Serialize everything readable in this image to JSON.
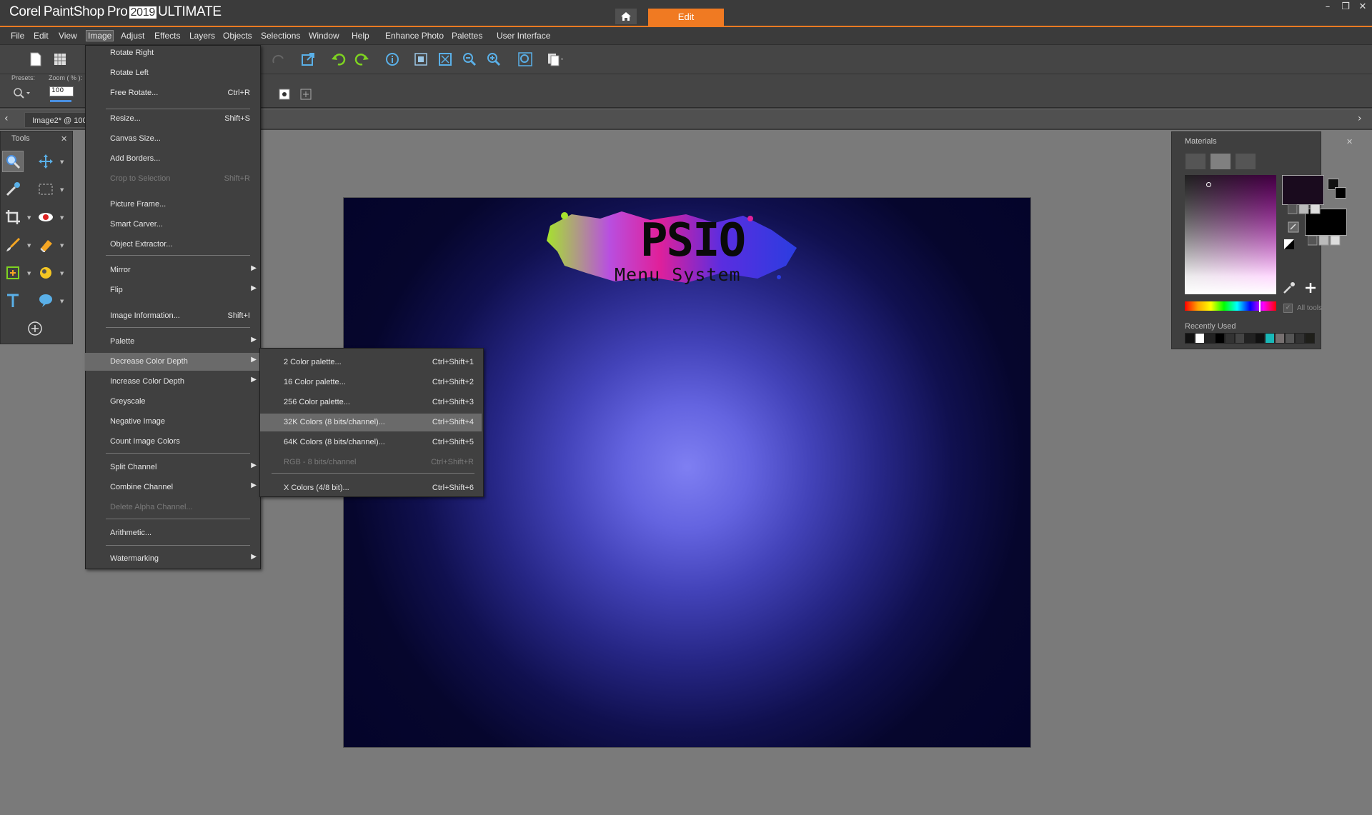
{
  "app": {
    "brand": "Corel",
    "name": "PaintShop",
    "suffix": "Pro",
    "year": "2019",
    "edition": "ULTIMATE",
    "mode_tab": "Edit"
  },
  "menubar": [
    "File",
    "Edit",
    "View",
    "Image",
    "Adjust",
    "Effects",
    "Layers",
    "Objects",
    "Selections",
    "Window",
    "Help",
    "Enhance Photo",
    "Palettes",
    "User Interface"
  ],
  "tool_options": {
    "presets_label": "Presets:",
    "zoom_label": "Zoom ( % ):",
    "zoom_value": "100"
  },
  "document_tab": "Image2* @ 100%",
  "tools_palette": {
    "title": "Tools"
  },
  "canvas": {
    "logo_main": "PSIO",
    "logo_sub": "Menu System"
  },
  "materials": {
    "title": "Materials",
    "all_tools": "All tools",
    "recently_used": "Recently Used",
    "recent_colors": [
      "#111111",
      "#ffffff",
      "#222222",
      "#000000",
      "#333333",
      "#444444",
      "#222222",
      "#111111",
      "#19b8b8",
      "#777070",
      "#555555",
      "#333333",
      "#1f1f1a"
    ]
  },
  "image_menu": [
    {
      "label": "Rotate Right",
      "shortcut": ""
    },
    {
      "label": "Rotate Left",
      "shortcut": ""
    },
    {
      "label": "Free Rotate...",
      "shortcut": "Ctrl+R"
    },
    {
      "label": "Resize...",
      "shortcut": "Shift+S"
    },
    {
      "label": "Canvas Size...",
      "shortcut": ""
    },
    {
      "label": "Add Borders...",
      "shortcut": ""
    },
    {
      "label": "Crop to Selection",
      "shortcut": "Shift+R"
    },
    {
      "label": "Picture Frame...",
      "shortcut": ""
    },
    {
      "label": "Smart Carver...",
      "shortcut": ""
    },
    {
      "label": "Object Extractor...",
      "shortcut": ""
    },
    {
      "label": "Mirror",
      "shortcut": ""
    },
    {
      "label": "Flip",
      "shortcut": ""
    },
    {
      "label": "Image Information...",
      "shortcut": "Shift+I"
    },
    {
      "label": "Palette",
      "shortcut": ""
    },
    {
      "label": "Decrease Color Depth",
      "shortcut": ""
    },
    {
      "label": "Increase Color Depth",
      "shortcut": ""
    },
    {
      "label": "Greyscale",
      "shortcut": ""
    },
    {
      "label": "Negative Image",
      "shortcut": ""
    },
    {
      "label": "Count Image Colors",
      "shortcut": ""
    },
    {
      "label": "Split Channel",
      "shortcut": ""
    },
    {
      "label": "Combine Channel",
      "shortcut": ""
    },
    {
      "label": "Delete Alpha Channel...",
      "shortcut": ""
    },
    {
      "label": "Arithmetic...",
      "shortcut": ""
    },
    {
      "label": "Watermarking",
      "shortcut": ""
    }
  ],
  "decrease_color_depth_submenu": [
    {
      "label": "2 Color palette...",
      "shortcut": "Ctrl+Shift+1"
    },
    {
      "label": "16 Color palette...",
      "shortcut": "Ctrl+Shift+2"
    },
    {
      "label": "256 Color palette...",
      "shortcut": "Ctrl+Shift+3"
    },
    {
      "label": "32K Colors (8 bits/channel)...",
      "shortcut": "Ctrl+Shift+4"
    },
    {
      "label": "64K Colors (8 bits/channel)...",
      "shortcut": "Ctrl+Shift+5"
    },
    {
      "label": "RGB - 8 bits/channel",
      "shortcut": "Ctrl+Shift+R"
    },
    {
      "label": "X Colors (4/8 bit)...",
      "shortcut": "Ctrl+Shift+6"
    }
  ],
  "colors": {
    "accent": "#f07a22",
    "chrome": "#3b3b3b",
    "workspace": "#7a7a7a"
  }
}
